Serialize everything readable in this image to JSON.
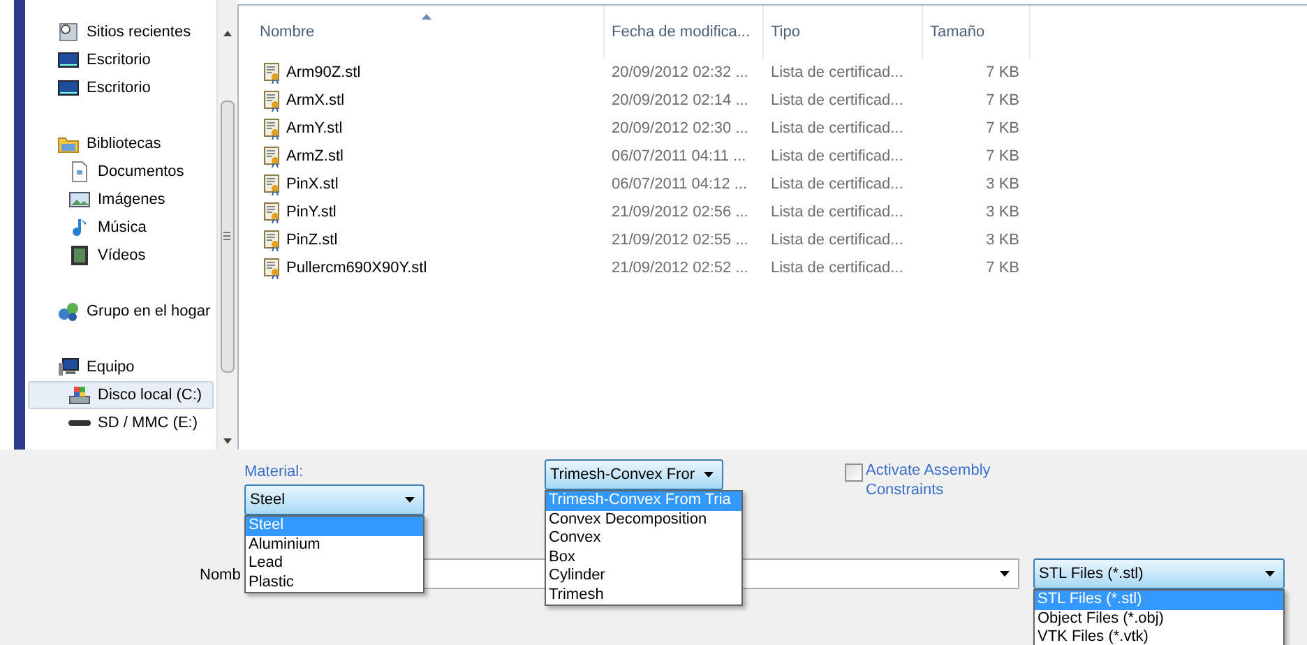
{
  "sidebar": {
    "items": [
      {
        "label": "Sitios recientes",
        "kind": "recent",
        "selected": false
      },
      {
        "label": "Escritorio",
        "kind": "desktop",
        "selected": false
      },
      {
        "label": "Escritorio",
        "kind": "desktop",
        "selected": false
      },
      {
        "label": "Bibliotecas",
        "kind": "library",
        "selected": false,
        "children": [
          {
            "label": "Documentos",
            "kind": "documents",
            "selected": false
          },
          {
            "label": "Imágenes",
            "kind": "pictures",
            "selected": false
          },
          {
            "label": "Música",
            "kind": "music",
            "selected": false
          },
          {
            "label": "Vídeos",
            "kind": "videos",
            "selected": false
          }
        ]
      },
      {
        "label": "Grupo en el hogar",
        "kind": "homegroup",
        "selected": false
      },
      {
        "label": "Equipo",
        "kind": "computer",
        "selected": false,
        "children": [
          {
            "label": "Disco local (C:)",
            "kind": "drive",
            "selected": true
          },
          {
            "label": "SD / MMC (E:)",
            "kind": "removable",
            "selected": false
          }
        ]
      }
    ]
  },
  "table": {
    "columns": [
      {
        "label": "Nombre",
        "sorted": true
      },
      {
        "label": "Fecha de modifica...",
        "sorted": false
      },
      {
        "label": "Tipo",
        "sorted": false
      },
      {
        "label": "Tamaño",
        "sorted": false
      }
    ],
    "rows": [
      [
        "Arm90Z.stl",
        "20/09/2012 02:32 ...",
        "Lista de certificad...",
        "7 KB"
      ],
      [
        "ArmX.stl",
        "20/09/2012 02:14 ...",
        "Lista de certificad...",
        "7 KB"
      ],
      [
        "ArmY.stl",
        "20/09/2012 02:30 ...",
        "Lista de certificad...",
        "7 KB"
      ],
      [
        "ArmZ.stl",
        "06/07/2011 04:11 ...",
        "Lista de certificad...",
        "7 KB"
      ],
      [
        "PinX.stl",
        "06/07/2011 04:12 ...",
        "Lista de certificad...",
        "3 KB"
      ],
      [
        "PinY.stl",
        "21/09/2012 02:56 ...",
        "Lista de certificad...",
        "3 KB"
      ],
      [
        "PinZ.stl",
        "21/09/2012 02:55 ...",
        "Lista de certificad...",
        "3 KB"
      ],
      [
        "Pullercm690X90Y.stl",
        "21/09/2012 02:52 ...",
        "Lista de certificad...",
        "7 KB"
      ]
    ]
  },
  "material": {
    "label": "Material:",
    "value": "Steel",
    "options": [
      {
        "label": "Steel",
        "selected": true
      },
      {
        "label": "Aluminium",
        "selected": false
      },
      {
        "label": "Lead",
        "selected": false
      },
      {
        "label": "Plastic",
        "selected": false
      }
    ]
  },
  "shape": {
    "value": "Trimesh-Convex Fror",
    "options": [
      {
        "label": "Trimesh-Convex From Tria",
        "selected": true
      },
      {
        "label": "Convex Decomposition",
        "selected": false
      },
      {
        "label": "Convex",
        "selected": false
      },
      {
        "label": "Box",
        "selected": false
      },
      {
        "label": "Cylinder",
        "selected": false
      },
      {
        "label": "Trimesh",
        "selected": false
      }
    ]
  },
  "assembly": {
    "label": "Activate Assembly Constraints",
    "checked": false
  },
  "filename": {
    "label": "Nomb"
  },
  "filetype": {
    "value": "STL Files (*.stl)",
    "options": [
      {
        "label": "STL Files (*.stl)",
        "selected": true
      },
      {
        "label": "Object Files (*.obj)",
        "selected": false
      },
      {
        "label": "VTK Files (*.vtk)",
        "selected": false
      }
    ]
  }
}
